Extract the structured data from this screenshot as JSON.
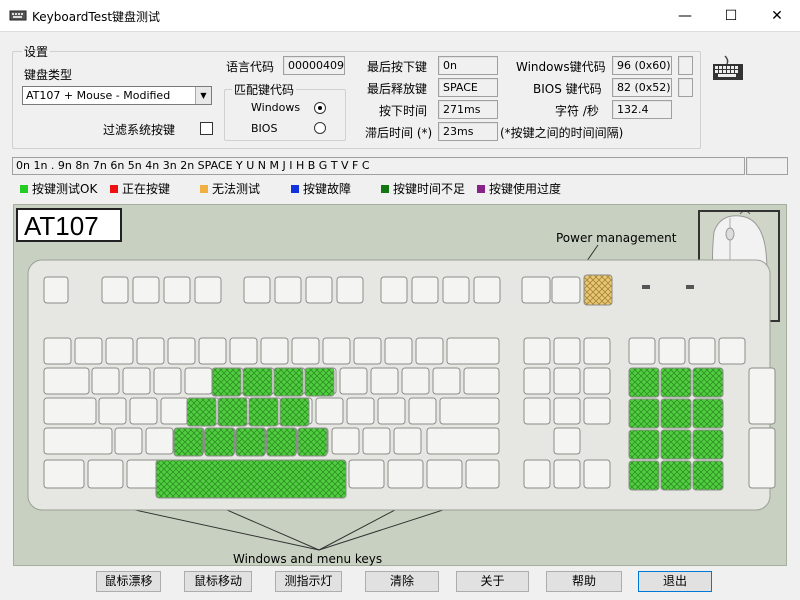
{
  "window": {
    "title": "KeyboardTest键盘测试",
    "minimize": "—",
    "maximize": "☐",
    "close": "✕"
  },
  "settings": {
    "group_label": "设置",
    "kb_type_label": "键盘类型",
    "kb_type_value": "AT107 + Mouse - Modified",
    "filter_label": "过滤系统按键",
    "lang_code_label": "语言代码",
    "lang_code_value": "00000409",
    "match_label": "匹配键代码",
    "match_windows": "Windows",
    "match_bios": "BIOS",
    "last_pressed_label": "最后按下键",
    "last_pressed_value": "0n",
    "last_released_label": "最后释放键",
    "last_released_value": "SPACE",
    "press_time_label": "按下时间",
    "press_time_value": "271ms",
    "lag_label": "滞后时间 (*)",
    "lag_value": "23ms",
    "win_code_label": "Windows键代码",
    "win_code_value": "96 (0x60)",
    "bios_code_label": "BIOS 键代码",
    "bios_code_value": "82 (0x52)",
    "cps_label": "字符 /秒",
    "cps_value": "132.4",
    "lag_note": "(*按键之间的时间间隔)"
  },
  "key_history": "0n 1n . 9n 8n 7n 6n 5n 4n 3n 2n SPACE Y U N M J I H B G T V F C",
  "legend": [
    {
      "label": "按键测试OK",
      "color": "#22cc22"
    },
    {
      "label": "正在按键",
      "color": "#ee1111"
    },
    {
      "label": "无法测试",
      "color": "#f0b040"
    },
    {
      "label": "按键故障",
      "color": "#1133dd"
    },
    {
      "label": "按键时间不足",
      "color": "#117711"
    },
    {
      "label": "按键使用过度",
      "color": "#882288"
    }
  ],
  "keyboard": {
    "model": "AT107",
    "power_caption": "Power management",
    "winkeys_caption": "Windows and menu keys"
  },
  "buttons": {
    "mouse_drift": "鼠标漂移",
    "mouse_move": "鼠标移动",
    "indicator": "测指示灯",
    "clear": "清除",
    "about": "关于",
    "help": "帮助",
    "exit": "退出"
  },
  "colors": {
    "accent": "#0078d7",
    "tested_green": "#4fcf3f"
  }
}
